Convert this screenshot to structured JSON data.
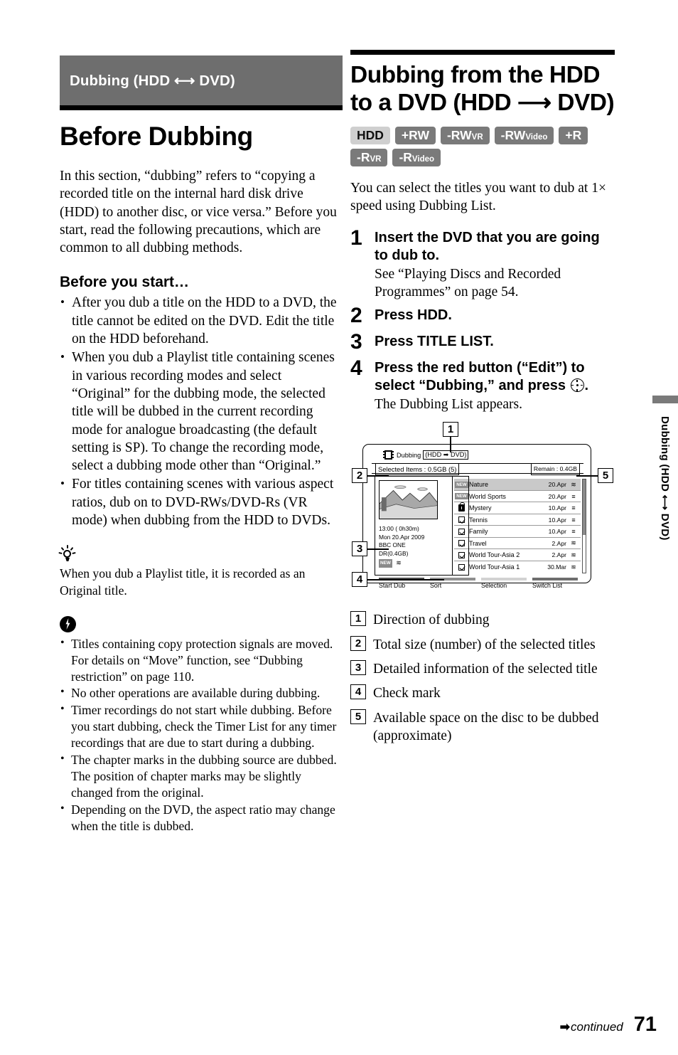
{
  "left": {
    "section_band": "Dubbing (HDD ⟷ DVD)",
    "title": "Before Dubbing",
    "intro": "In this section, “dubbing” refers to “copying a recorded title on the internal hard disk drive (HDD) to another disc, or vice versa.” Before you start, read the following precautions, which are common to all dubbing methods.",
    "subhead": "Before you start…",
    "bullets": [
      "After you dub a title on the HDD to a DVD, the title cannot be edited on the DVD. Edit the title on the HDD beforehand.",
      "When you dub a Playlist title containing scenes in various recording modes and select “Original” for the dubbing mode, the selected title will be dubbed in the current recording mode for analogue broadcasting (the default setting is SP). To change the recording mode, select a dubbing mode other than “Original.”",
      "For titles containing scenes with various aspect ratios, dub on to DVD-RWs/DVD-Rs (VR mode) when dubbing from the HDD to DVDs."
    ],
    "tip_icon": "lightbulb-icon",
    "tip_text": "When you dub a Playlist title, it is recorded as an Original title.",
    "note_icon": "note-bolt-icon",
    "notes": [
      "Titles containing copy protection signals are moved. For details on “Move” function, see “Dubbing restriction” on page 110.",
      "No other operations are available during dubbing.",
      "Timer recordings do not start while dubbing. Before you start dubbing, check the Timer List for any timer recordings that are due to start during a dubbing.",
      "The chapter marks in the dubbing source are dubbed. The position of chapter marks may be slightly changed from the original.",
      "Depending on the DVD, the aspect ratio may change when the title is dubbed."
    ]
  },
  "right": {
    "title": "Dubbing from the HDD to a DVD (HDD ⟶ DVD)",
    "badges_row1": [
      {
        "label": "HDD",
        "sub": "",
        "style": "light"
      },
      {
        "label": "+RW",
        "sub": "",
        "style": "dark"
      },
      {
        "label": "-RW",
        "sub": "VR",
        "style": "dark"
      },
      {
        "label": "-RW",
        "sub": "Video",
        "style": "dark"
      },
      {
        "label": "+R",
        "sub": "",
        "style": "dark"
      }
    ],
    "badges_row2": [
      {
        "label": "-R",
        "sub": "VR",
        "style": "dark"
      },
      {
        "label": "-R",
        "sub": "Video",
        "style": "dark"
      }
    ],
    "intro": "You can select the titles you want to dub at 1× speed using Dubbing List.",
    "steps": [
      {
        "num": "1",
        "head": "Insert the DVD that you are going to dub to.",
        "sub": "See “Playing Discs and Recorded Programmes” on page 54."
      },
      {
        "num": "2",
        "head": "Press HDD.",
        "sub": ""
      },
      {
        "num": "3",
        "head": "Press TITLE LIST.",
        "sub": ""
      },
      {
        "num": "4",
        "head_pre": "Press the red button (“Edit”) to select “Dubbing,” and press",
        "head_post": ".",
        "sub": "The Dubbing List appears."
      }
    ],
    "legend": [
      {
        "num": "1",
        "text": "Direction of dubbing"
      },
      {
        "num": "2",
        "text": "Total size (number) of the selected titles"
      },
      {
        "num": "3",
        "text": "Detailed information of the selected title"
      },
      {
        "num": "4",
        "text": "Check mark"
      },
      {
        "num": "5",
        "text": "Available space on the disc to be dubbed (approximate)"
      }
    ]
  },
  "screen": {
    "header_label": "Dubbing",
    "header_direction": "(HDD ➡ DVD)",
    "selected_items": "Selected Items : 0.5GB (5)",
    "remain": "Remain : 0.4GB",
    "info": {
      "time": "13:00 ( 0h30m)",
      "date": "Mon 20.Apr 2009",
      "channel": "BBC ONE",
      "mode": "DR(0.4GB)",
      "tag": "NEW"
    },
    "rows": [
      {
        "icon": "new-tag",
        "name": "Nature",
        "date": "20.Apr",
        "type": "≋",
        "selected": true
      },
      {
        "icon": "new-tag",
        "name": "World Sports",
        "date": "20.Apr",
        "type": "≡",
        "selected": false
      },
      {
        "icon": "lock-icon",
        "name": "Mystery",
        "date": "10.Apr",
        "type": "≡",
        "selected": false
      },
      {
        "icon": "check-icon",
        "name": "Tennis",
        "date": "10.Apr",
        "type": "≡",
        "selected": false
      },
      {
        "icon": "check-icon",
        "name": "Family",
        "date": "10.Apr",
        "type": "≡",
        "selected": false
      },
      {
        "icon": "check-icon",
        "name": "Travel",
        "date": "2.Apr",
        "type": "≋",
        "selected": false
      },
      {
        "icon": "check-icon",
        "name": "World Tour-Asia 2",
        "date": "2.Apr",
        "type": "≋",
        "selected": false
      },
      {
        "icon": "check-icon",
        "name": "World Tour-Asia 1",
        "date": "30.Mar",
        "type": "≋",
        "selected": false
      }
    ],
    "commands": [
      {
        "label": "Start Dub",
        "color": "#4a4a4a"
      },
      {
        "label": "Sort",
        "color": "#8f8f8f"
      },
      {
        "label": "Selection",
        "color": "#d2d2d2"
      },
      {
        "label": "Switch List",
        "color": "#6e6e6e"
      }
    ],
    "callouts": [
      "1",
      "2",
      "3",
      "4",
      "5"
    ]
  },
  "side_tab": "Dubbing (HDD ⟷ DVD)",
  "footer": {
    "arrow": "➡",
    "continued": "continued",
    "page": "71"
  }
}
